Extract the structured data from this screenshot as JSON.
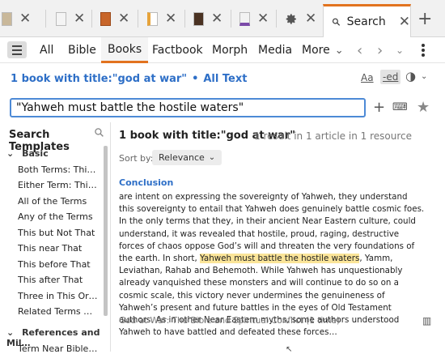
{
  "tabs": {
    "items": [
      {
        "name": "tab-1"
      },
      {
        "name": "tab-2"
      },
      {
        "name": "tab-3"
      },
      {
        "name": "tab-4"
      },
      {
        "name": "tab-5"
      },
      {
        "name": "tab-6"
      },
      {
        "name": "tab-7"
      }
    ],
    "active_label": "Search",
    "close_glyph": "✕",
    "new_tab_glyph": "+"
  },
  "nav": {
    "tabs": [
      "All",
      "Bible",
      "Books",
      "Factbook",
      "Morph",
      "Media",
      "More"
    ],
    "active_tab": "Books"
  },
  "header": {
    "query_summary": "1 book with title:\"god at war\"",
    "bullet": "•",
    "scope": "All Text",
    "aa_label": "Aa",
    "ed_label": "-ed"
  },
  "search": {
    "value": "\"Yahweh must battle the hostile waters\""
  },
  "templates": {
    "title": "Search Templates",
    "groups": [
      {
        "label": "Basic",
        "items": [
          "Both Terms: This a…",
          "Either Term: This o…",
          "All of the Terms",
          "Any of the Terms",
          "This but Not That",
          "This near That",
          "This before That",
          "This after That",
          "Three in This Order",
          "Related Terms Nea…"
        ]
      },
      {
        "label": "References and Mil…",
        "items": [
          "Term Near Bible Re…"
        ]
      }
    ]
  },
  "results": {
    "title": "1 book with title:\"god at war\"",
    "count": "1 result in 1 article in 1 resource",
    "sort_label": "Sort by:",
    "sort_value": "Relevance",
    "heading": "Conclusion",
    "snippet_before": "are intent on expressing the sovereignty of Yahweh, they understand this sovereignty to entail that Yahweh does genuinely battle cosmic foes. In the only terms that they, in their ancient Near Eastern culture, could understand, it was revealed that hostile, proud, raging, destructive forces of chaos oppose God’s will and threaten the very foundations of the earth. In short, ",
    "snippet_highlight": "Yahweh must battle the hostile waters",
    "snippet_after": ", Yamm, Leviathan, Rahab and Behemoth. While Yahweh has unquestionably already vanquished these monsters and will continue to do so on a cosmic scale, this victory never undermines the genuineness of Yahweh’s present and future battles in the eyes of Old Testament authors. As in other Near Eastern myths, some authors understood Yahweh to have battled and defeated these forces…",
    "source": "God at War: The Bible and Spiritual Conflict (1 time)"
  },
  "colors": {
    "accent": "#e2731f",
    "link": "#2e6fc7",
    "highlight": "#fbe599"
  }
}
